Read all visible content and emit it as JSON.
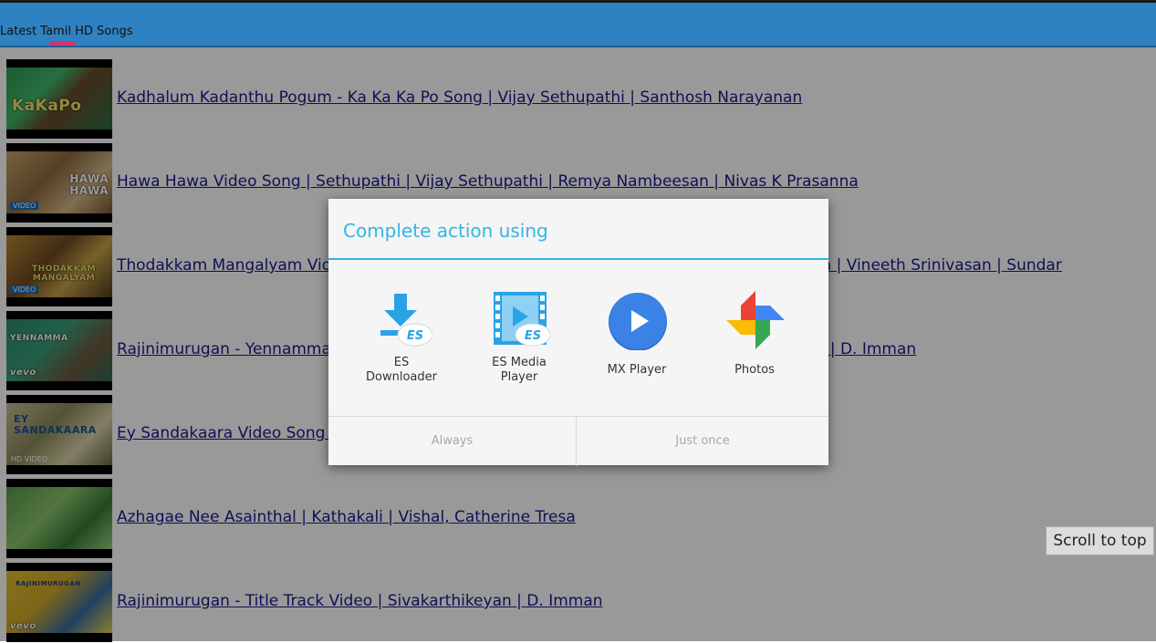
{
  "header": {
    "title": "Latest Tamil HD Songs"
  },
  "videos": [
    {
      "title": "Kadhalum Kadanthu Pogum - Ka Ka Ka Po Song | Vijay Sethupathi | Santhosh Narayanan ",
      "thumb_caption": "KaKaPo"
    },
    {
      "title": "Hawa Hawa Video Song | Sethupathi | Vijay Sethupathi | Remya Nambeesan | Nivas K Prasanna ",
      "thumb_caption": "HAWA HAWA"
    },
    {
      "title": "Thodakkam Mangalyam Video Song | Jacobinte Swargarajyam | Nivin Pauly | Shaan Rahman | Vineeth Srinivasan | Sundar ",
      "thumb_caption": "THODAKKAM MANGALYAM"
    },
    {
      "title": "Rajinimurugan - Yennamma Ippadi Panreengalema Video | Sivakarthikeyan, Keerthy Suresh | D. Imman ",
      "thumb_caption": "YENNAMMA"
    },
    {
      "title": "Ey Sandakaara Video Song | Irudhi Suttru | Madhavan, Ritika Singh | Santhosh Narayanan ",
      "thumb_caption": "EY SANDAKAARA"
    },
    {
      "title": "Azhagae Nee Asainthal | Kathakali | Vishal, Catherine Tresa ",
      "thumb_caption": ""
    },
    {
      "title": "Rajinimurugan - Title Track Video | Sivakarthikeyan | D. Imman ",
      "thumb_caption": "RAJINIMURUGAN"
    }
  ],
  "scroll_to_top": "Scroll to top",
  "dialog": {
    "title": "Complete action using",
    "options": [
      {
        "name": "es-downloader",
        "label_line1": "ES",
        "label_line2": "Downloader",
        "icon": "download-icon"
      },
      {
        "name": "es-media-player",
        "label_line1": "ES Media",
        "label_line2": "Player",
        "icon": "film-play-icon"
      },
      {
        "name": "mx-player",
        "label_line1": "MX Player",
        "label_line2": "",
        "icon": "play-icon"
      },
      {
        "name": "photos",
        "label_line1": "Photos",
        "label_line2": "",
        "icon": "pinwheel-icon"
      }
    ],
    "always_label": "Always",
    "just_once_label": "Just once"
  },
  "colors": {
    "header_bg": "#2e82c2",
    "accent": "#33b5e5",
    "link": "#1a1a8c",
    "mx_blue": "#3b82e6"
  }
}
